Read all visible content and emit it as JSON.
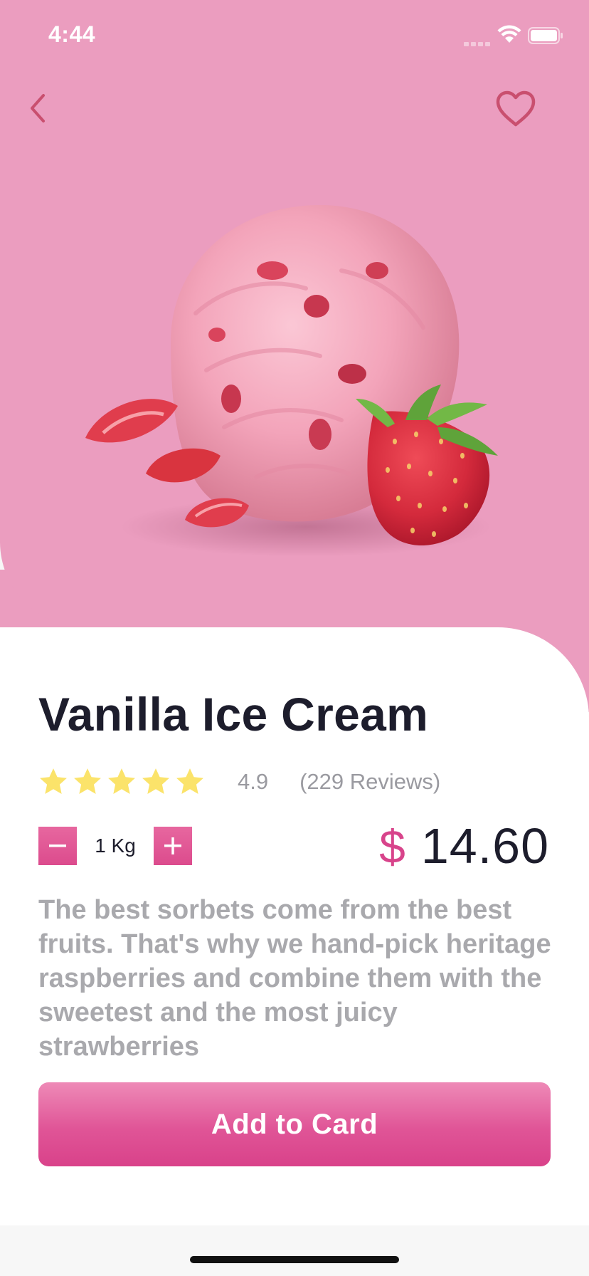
{
  "status_bar": {
    "time": "4:44"
  },
  "hero": {
    "background_color": "#eb9dbf",
    "back_icon": "chevron-left-icon",
    "favorite_icon": "heart-outline-icon",
    "icon_color": "#c94f6f",
    "image": "strawberry-ice-cream-scoop"
  },
  "product": {
    "title": "Vanilla Ice Cream",
    "rating": {
      "stars": 5,
      "value": "4.9",
      "reviews": "(229 Reviews)",
      "star_color": "#fbe36a"
    },
    "quantity": {
      "value": "1 Kg",
      "decrease_icon": "minus-icon",
      "increase_icon": "plus-icon"
    },
    "price": {
      "currency": "$",
      "amount": "14.60"
    },
    "description": "The best sorbets come from the best fruits. That's why we hand-pick heritage raspberries and combine them with the sweetest and the most juicy strawberries"
  },
  "actions": {
    "add_label": "Add to Card"
  },
  "colors": {
    "accent": "#dc4b8d",
    "title": "#1d1d2c",
    "muted": "#a9a9ad"
  }
}
